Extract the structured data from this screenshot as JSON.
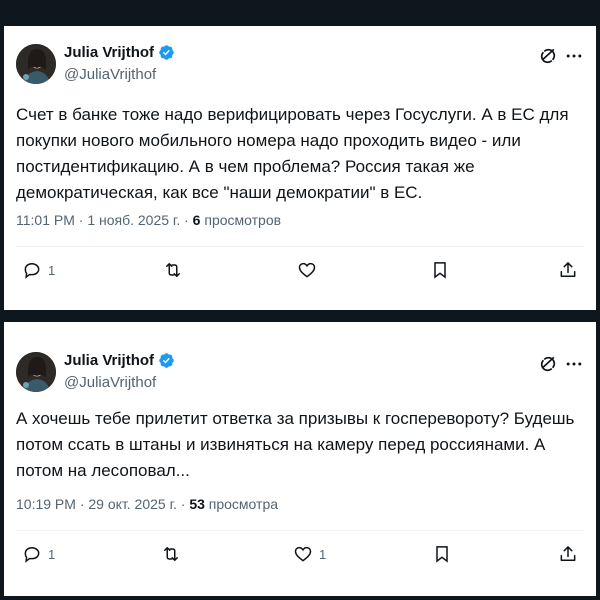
{
  "tweets": [
    {
      "author": "Julia Vrijthof",
      "handle": "@JuliaVrijthof",
      "text": "Счет в банке тоже надо верифицировать через Госуслуги. А в ЕС для покупки нового мобильного номера надо проходить видео - или постидентификацию. А в чем проблема? Россия такая же демократическая, как все \"наши демократии\" в ЕС.",
      "time": "11:01 PM · 1 нояб. 2025 г. · ",
      "views_count": "6",
      "views_label": " просмотров",
      "replies": "1",
      "reposts": "",
      "likes": "",
      "icons": [
        "grok-icon",
        "more-icon",
        "reply-icon",
        "repost-icon",
        "like-icon",
        "bookmark-icon",
        "share-icon"
      ]
    },
    {
      "author": "Julia Vrijthof",
      "handle": "@JuliaVrijthof",
      "text": "А хочешь тебе прилетит ответка за призывы к госперевороту? Будешь потом ссать в штаны и извиняться на камеру перед россиянами. А потом на лесоповал...",
      "time": "10:19 PM · 29 окт. 2025 г. · ",
      "views_count": "53",
      "views_label": " просмотра",
      "replies": "1",
      "reposts": "",
      "likes": "1",
      "icons": [
        "grok-icon",
        "more-icon",
        "reply-icon",
        "repost-icon",
        "like-icon",
        "bookmark-icon",
        "share-icon"
      ]
    }
  ],
  "colors": {
    "background": "#0e171d",
    "card": "#ffffff",
    "verified": "#1d9bf0",
    "secondary_text": "#536471"
  }
}
